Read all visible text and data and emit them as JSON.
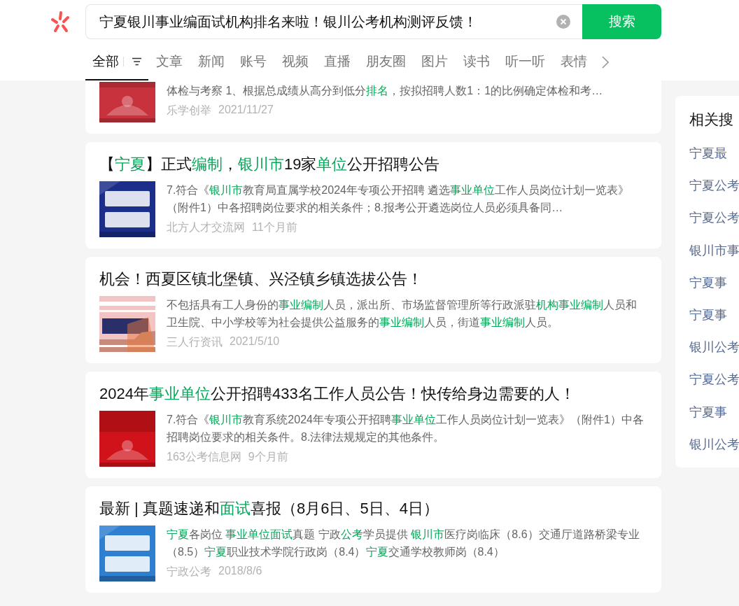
{
  "search": {
    "value": "宁夏银川事业编面试机构排名来啦！银川公考机构测评反馈！",
    "button": "搜索"
  },
  "tabs": [
    {
      "label": "全部",
      "selected": true
    },
    {
      "label": "文章",
      "selected": false
    },
    {
      "label": "新闻",
      "selected": false
    },
    {
      "label": "账号",
      "selected": false
    },
    {
      "label": "视频",
      "selected": false
    },
    {
      "label": "直播",
      "selected": false
    },
    {
      "label": "朋友圈",
      "selected": false
    },
    {
      "label": "图片",
      "selected": false
    },
    {
      "label": "读书",
      "selected": false
    },
    {
      "label": "听一听",
      "selected": false
    },
    {
      "label": "表情",
      "selected": false
    }
  ],
  "results": [
    {
      "snippet": [
        {
          "text": "体检与考察 1、根据总成绩从高分到低分",
          "hl": false
        },
        {
          "text": "排名",
          "hl": true
        },
        {
          "text": "，按拟招聘人数1：1的比例确定体检和考…",
          "hl": false
        }
      ],
      "source": "乐学创举",
      "time": "2021/11/27",
      "thumb": {
        "kind": "picture"
      }
    },
    {
      "title": [
        {
          "text": "【",
          "hl": false
        },
        {
          "text": "宁夏",
          "hl": true
        },
        {
          "text": "】正式",
          "hl": false
        },
        {
          "text": "编制",
          "hl": true
        },
        {
          "text": "，",
          "hl": false
        },
        {
          "text": "银川市",
          "hl": true
        },
        {
          "text": "19家",
          "hl": false
        },
        {
          "text": "单位",
          "hl": true
        },
        {
          "text": "公开招聘公告",
          "hl": false
        }
      ],
      "snippet": [
        {
          "text": "7.符合《",
          "hl": false
        },
        {
          "text": "银川市",
          "hl": true
        },
        {
          "text": "教育局直属学校2024年专项公开招聘 遴选",
          "hl": false
        },
        {
          "text": "事业单位",
          "hl": true
        },
        {
          "text": "工作人员岗位计划一览表》（附件1）中各招聘岗位要求的相关条件；8.报考公开遴选岗位人员必须具备同…",
          "hl": false
        }
      ],
      "source": "北方人才交流网",
      "time": "11个月前",
      "thumb": {
        "kind": "picture"
      }
    },
    {
      "title": [
        {
          "text": "机会！西夏区镇北堡镇、兴泾镇乡镇选拔公告！",
          "hl": false
        }
      ],
      "snippet": [
        {
          "text": "不包括具有工人身份的",
          "hl": false
        },
        {
          "text": "事业编制",
          "hl": true
        },
        {
          "text": "人员，派出所、市场监督管理所等行政派驻",
          "hl": false
        },
        {
          "text": "机构事业编制",
          "hl": true
        },
        {
          "text": "人员和卫生院、中小学校等为社会提供公益服务的",
          "hl": false
        },
        {
          "text": "事业编制",
          "hl": true
        },
        {
          "text": "人员，街道",
          "hl": false
        },
        {
          "text": "事业编制",
          "hl": true
        },
        {
          "text": "人员。",
          "hl": false
        }
      ],
      "source": "三人行资讯",
      "time": "2021/5/10",
      "thumb": {
        "kind": "picture"
      }
    },
    {
      "title": [
        {
          "text": "2024年",
          "hl": false
        },
        {
          "text": "事业单位",
          "hl": true
        },
        {
          "text": "公开招聘433名工作人员公告！快传给身边需要的人！",
          "hl": false
        }
      ],
      "snippet": [
        {
          "text": "7.符合《",
          "hl": false
        },
        {
          "text": "银川市",
          "hl": true
        },
        {
          "text": "教育系统2024年专项公开招聘",
          "hl": false
        },
        {
          "text": "事业单位",
          "hl": true
        },
        {
          "text": "工作人员岗位计划一览表》（附件1）中各招聘岗位要求的相关条件。8.法律法规规定的其他条件。",
          "hl": false
        }
      ],
      "source": "163公考信息网",
      "time": "9个月前",
      "thumb": {
        "kind": "picture"
      }
    },
    {
      "title": [
        {
          "text": "最新 | 真题速递和",
          "hl": false
        },
        {
          "text": "面试",
          "hl": true
        },
        {
          "text": "喜报（8月6日、5日、4日）",
          "hl": false
        }
      ],
      "snippet": [
        {
          "text": "宁夏",
          "hl": true
        },
        {
          "text": "各岗位 ",
          "hl": false
        },
        {
          "text": "事业单位面试",
          "hl": true
        },
        {
          "text": "真题 宁政",
          "hl": false
        },
        {
          "text": "公考",
          "hl": true
        },
        {
          "text": "学员提供 ",
          "hl": false
        },
        {
          "text": "银川市",
          "hl": true
        },
        {
          "text": "医疗岗临床（8.6）交通厅道路桥梁专业（8.5）",
          "hl": false
        },
        {
          "text": "宁夏",
          "hl": true
        },
        {
          "text": "职业技术学院行政岗（8.4）",
          "hl": false
        },
        {
          "text": "宁夏",
          "hl": true
        },
        {
          "text": "交通学校教师岗（8.4）",
          "hl": false
        }
      ],
      "source": "宁政公考",
      "time": "2018/8/6",
      "thumb": {
        "kind": "picture"
      }
    }
  ],
  "related": {
    "title": "相关搜",
    "items": [
      "宁夏最",
      "宁夏公考",
      "宁夏公考",
      "银川市事",
      "宁夏事",
      "宁夏事",
      "银川公考",
      "宁夏公考",
      "宁夏事",
      "银川公考"
    ]
  }
}
